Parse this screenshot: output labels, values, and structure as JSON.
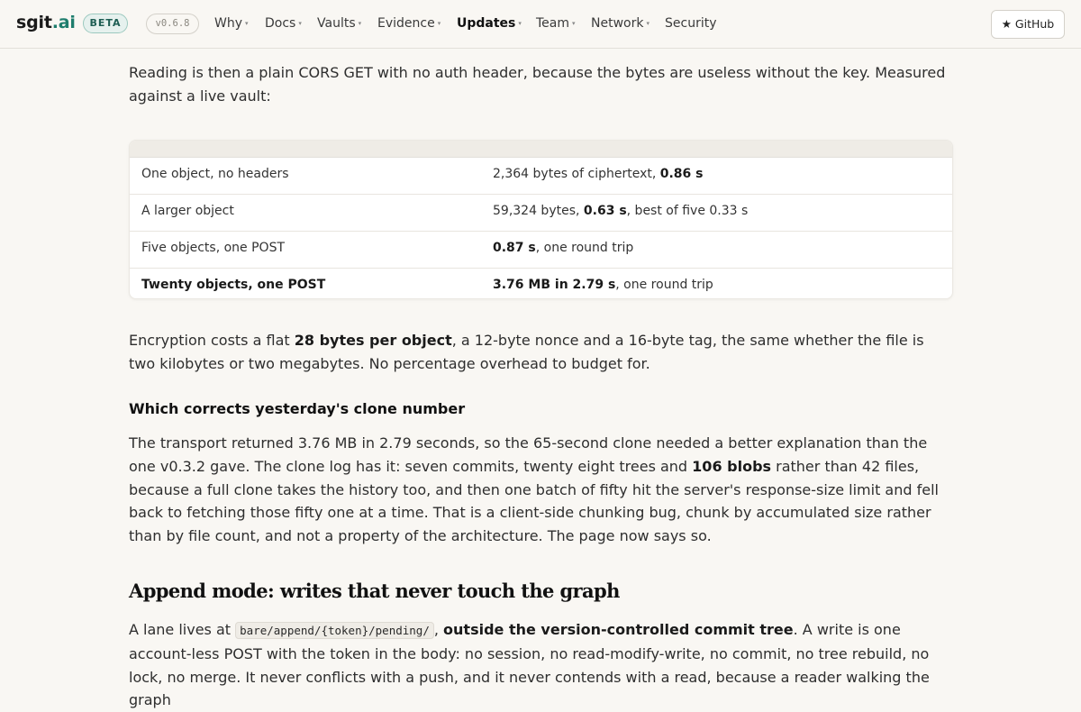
{
  "header": {
    "brand_main": "sgit",
    "brand_tld": ".ai",
    "beta_badge": "BETA",
    "version": "v0.6.8",
    "nav": [
      {
        "label": "Why",
        "has_menu": true,
        "active": false
      },
      {
        "label": "Docs",
        "has_menu": true,
        "active": false
      },
      {
        "label": "Vaults",
        "has_menu": true,
        "active": false
      },
      {
        "label": "Evidence",
        "has_menu": true,
        "active": false
      },
      {
        "label": "Updates",
        "has_menu": true,
        "active": true
      },
      {
        "label": "Team",
        "has_menu": true,
        "active": false
      },
      {
        "label": "Network",
        "has_menu": true,
        "active": false
      },
      {
        "label": "Security",
        "has_menu": false,
        "active": false
      }
    ],
    "caret_glyph": "▾",
    "github_label": "★ GitHub"
  },
  "intro": {
    "text": "Reading is then a plain CORS GET with no auth header, because the bytes are useless without the key. Measured against a live vault:"
  },
  "table": {
    "rows": [
      {
        "label": "One object, no headers",
        "label_bold": false,
        "pre": "2,364 bytes of ciphertext, ",
        "bold": "0.86 s",
        "post": ""
      },
      {
        "label": "A larger object",
        "label_bold": false,
        "pre": "59,324 bytes, ",
        "bold": "0.63 s",
        "post": ", best of five 0.33 s"
      },
      {
        "label": "Five objects, one POST",
        "label_bold": false,
        "pre": "",
        "bold": "0.87 s",
        "post": ", one round trip"
      },
      {
        "label": "Twenty objects, one POST",
        "label_bold": true,
        "pre": "",
        "bold": "3.76 MB in 2.79 s",
        "post": ", one round trip"
      }
    ]
  },
  "encryption": {
    "pre": "Encryption costs a flat ",
    "bold": "28 bytes per object",
    "post": ", a 12-byte nonce and a 16-byte tag, the same whether the file is two kilobytes or two megabytes. No percentage overhead to budget for."
  },
  "correction": {
    "heading": "Which corrects yesterday's clone number",
    "pre": "The transport returned 3.76 MB in 2.79 seconds, so the 65-second clone needed a better explanation than the one v0.3.2 gave. The clone log has it: seven commits, twenty eight trees and ",
    "bold": "106 blobs",
    "post": " rather than 42 files, because a full clone takes the history too, and then one batch of fifty hit the server's response-size limit and fell back to fetching those fifty one at a time. That is a client-side chunking bug, chunk by accumulated size rather than by file count, and not a property of the architecture. The page now says so."
  },
  "append": {
    "heading": "Append mode: writes that never touch the graph",
    "pre": "A lane lives at ",
    "code": "bare/append/{token}/pending/",
    "mid": ", ",
    "bold": "outside the version-controlled commit tree",
    "post": ". A write is one account-less POST with the token in the body: no session, no read-modify-write, no commit, no tree rebuild, no lock, no merge. It never conflicts with a push, and it never contends with a read, because a reader walking the graph"
  }
}
